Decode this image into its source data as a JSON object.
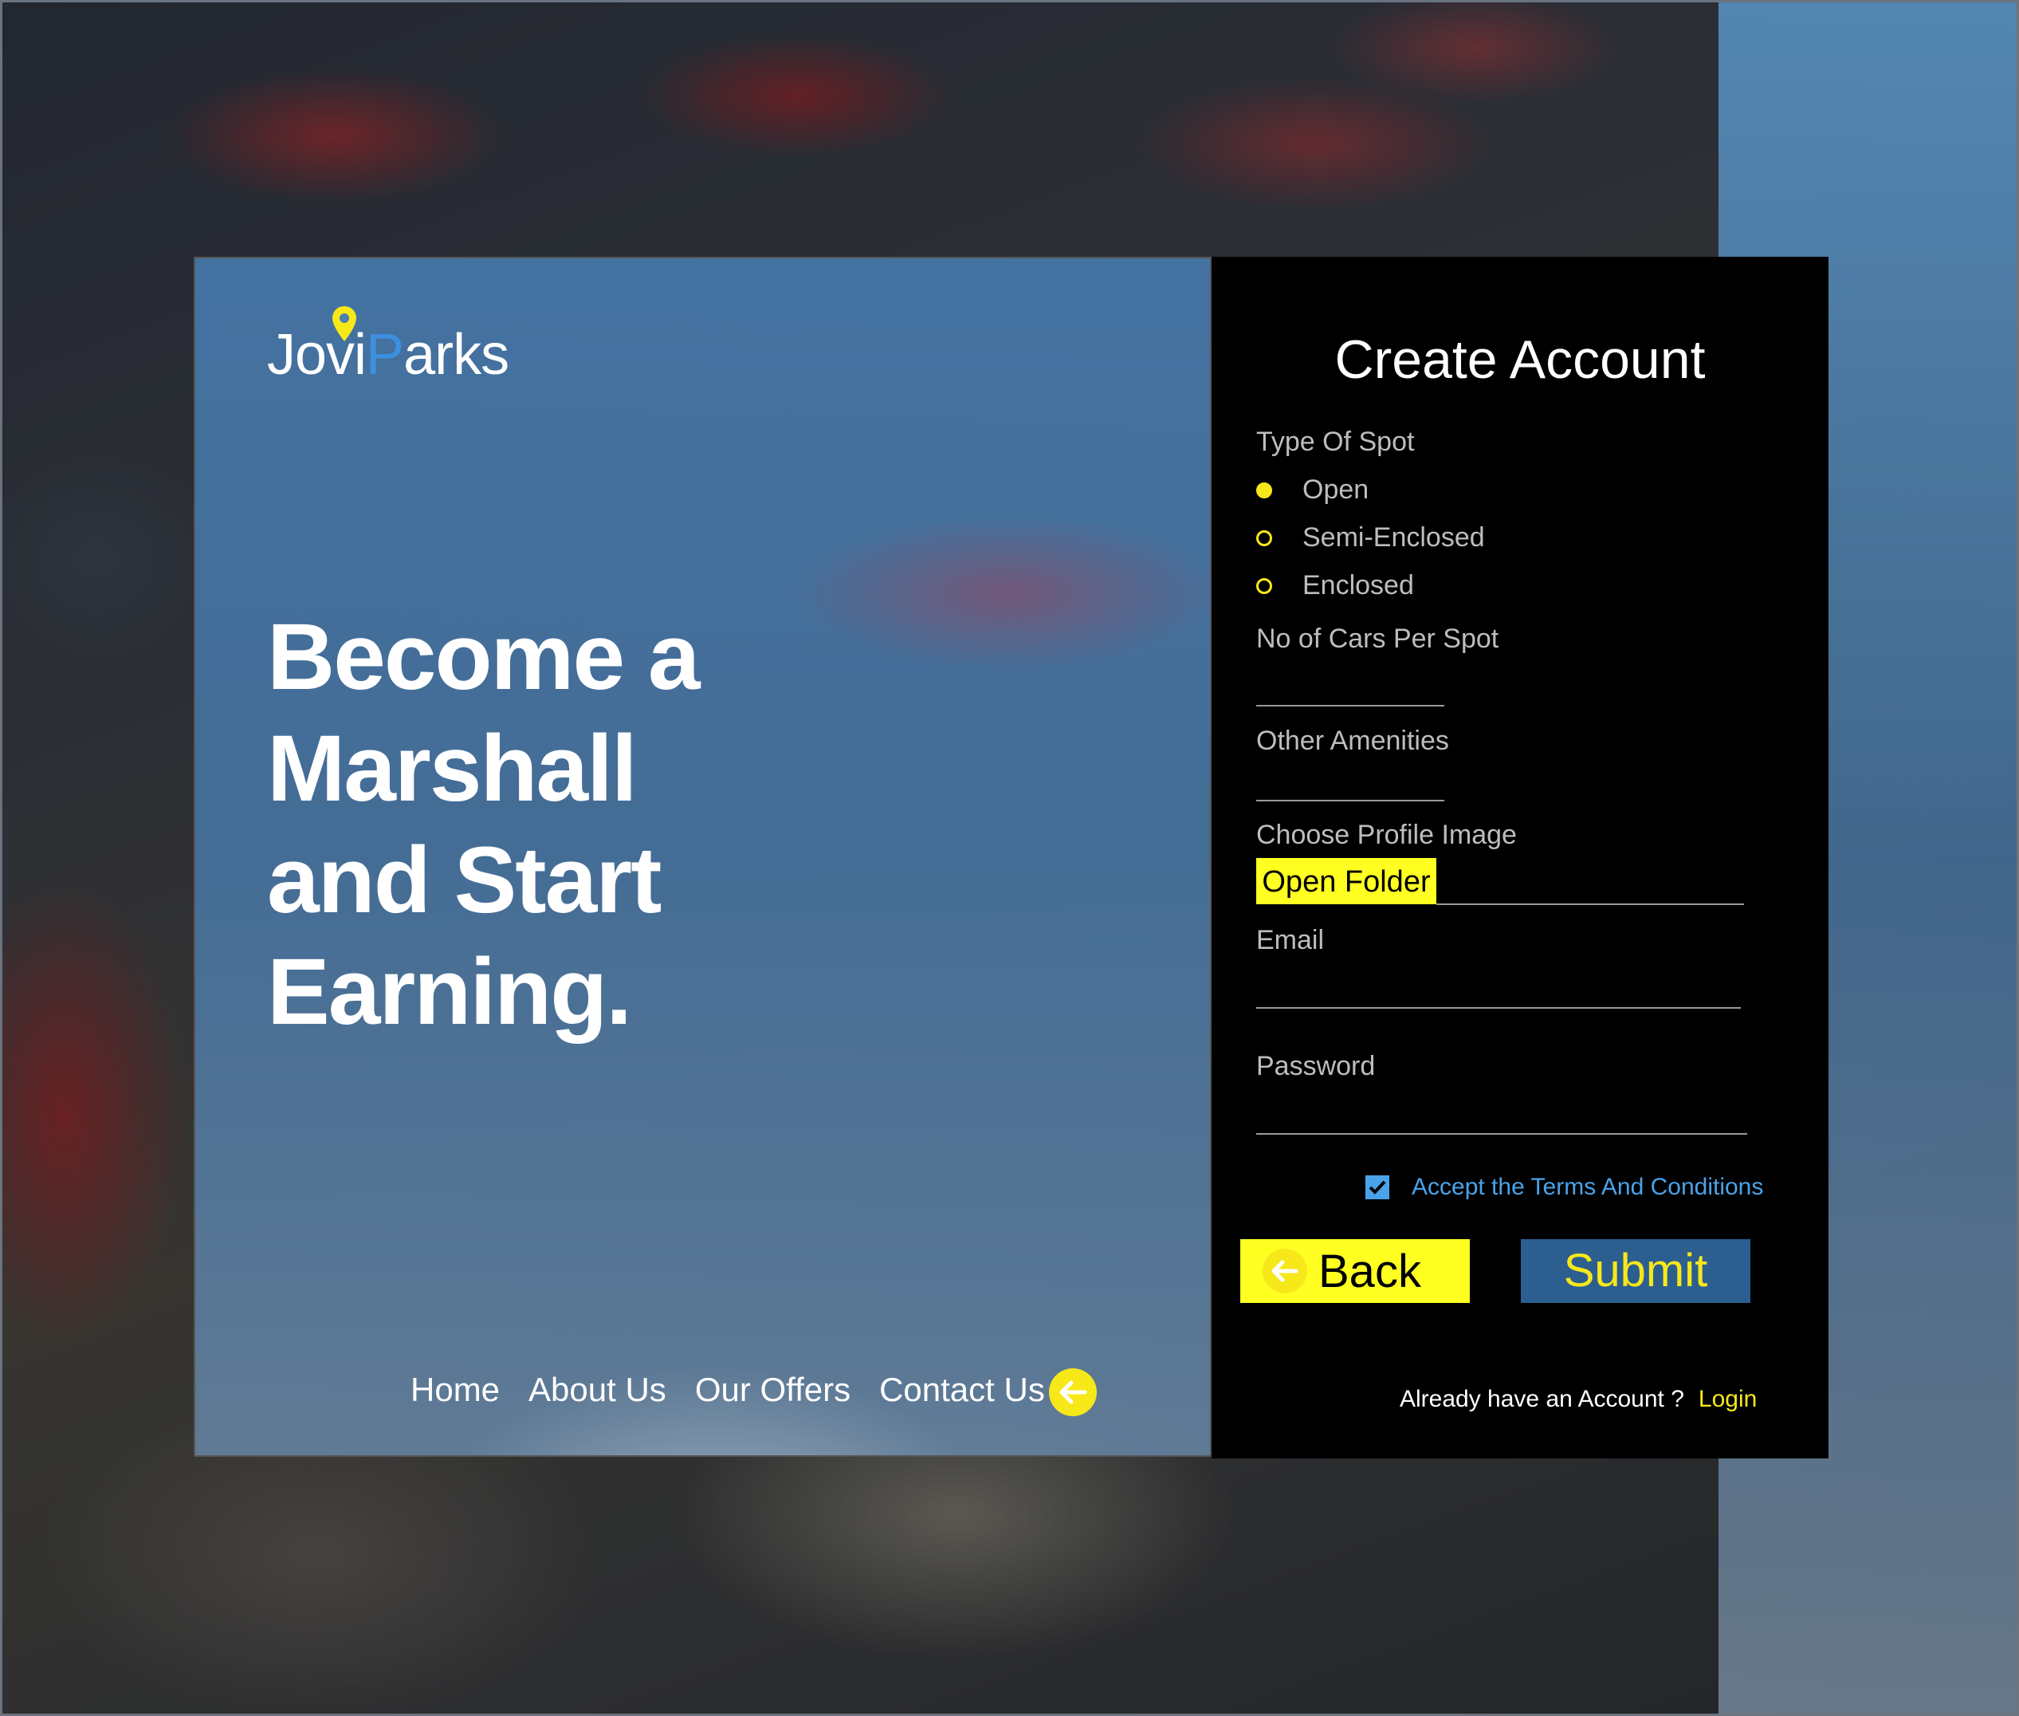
{
  "brand": {
    "logo_prefix": "Jovi",
    "logo_p": "P",
    "logo_suffix": "arks"
  },
  "hero": {
    "headline_line1": "Become a Marshall",
    "headline_line2": "and Start Earning."
  },
  "nav": {
    "items": [
      "Home",
      "About Us",
      "Our Offers",
      "Contact Us"
    ]
  },
  "form": {
    "title": "Create Account",
    "type_of_spot_label": "Type Of Spot",
    "spot_options": [
      {
        "label": "Open",
        "selected": true
      },
      {
        "label": "Semi-Enclosed",
        "selected": false
      },
      {
        "label": "Enclosed",
        "selected": false
      }
    ],
    "cars_per_spot_label": "No of Cars Per Spot",
    "amenities_label": "Other Amenities",
    "profile_image_label": "Choose Profile Image",
    "open_folder_label": "Open Folder",
    "email_label": "Email",
    "password_label": "Password",
    "terms_label": "Accept the Terms And Conditions",
    "terms_checked": true,
    "back_label": "Back",
    "submit_label": "Submit",
    "already_text": "Already have an Account ?",
    "login_label": "Login"
  },
  "colors": {
    "accent_yellow": "#f7e81a",
    "accent_blue": "#3d8fe0",
    "submit_bg": "#2c5f8f",
    "form_bg": "#000000"
  }
}
